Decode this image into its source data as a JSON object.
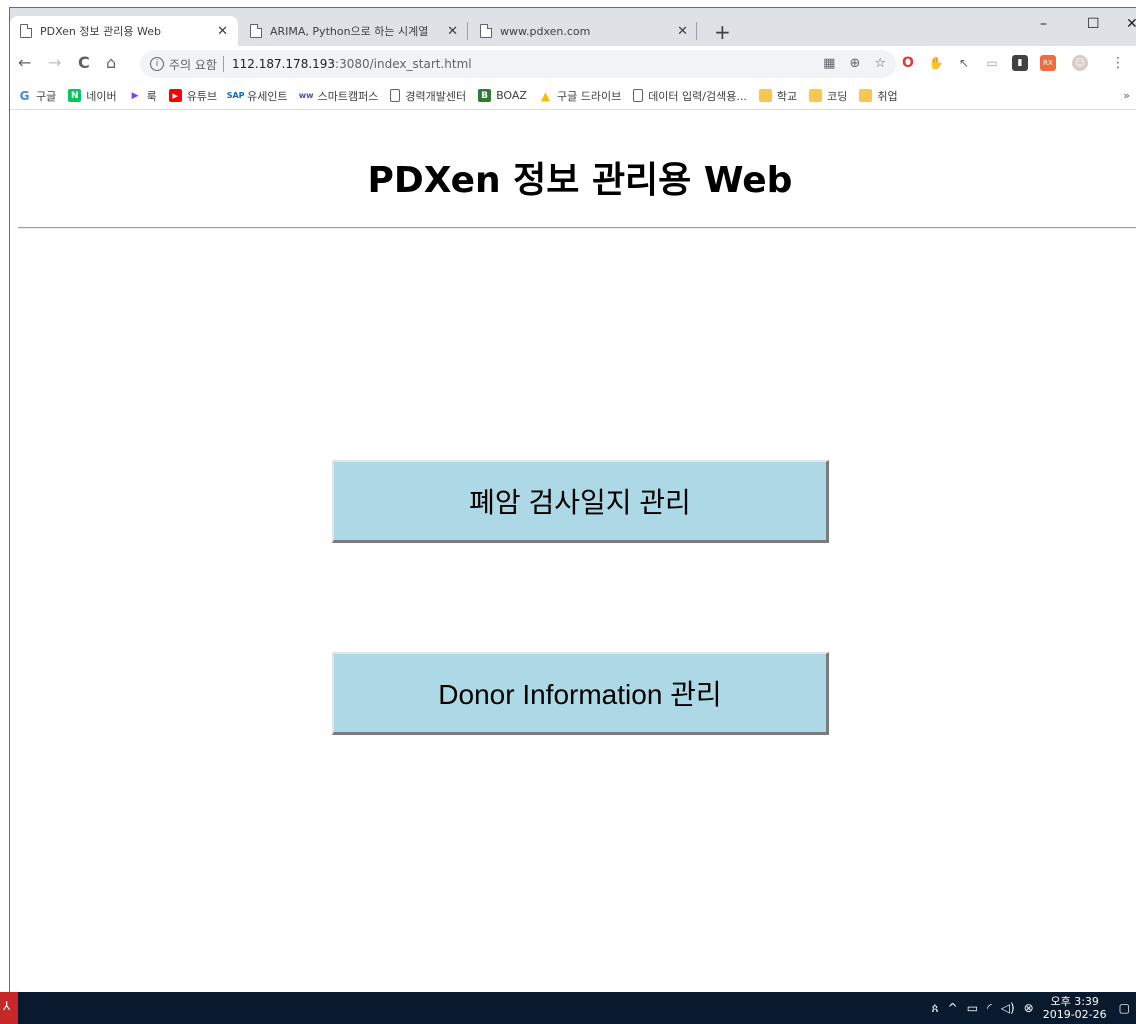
{
  "window": {
    "controls": {
      "minimize": "–",
      "maximize": "☐",
      "close": "✕"
    }
  },
  "tabs": [
    {
      "title": "PDXen 정보 관리용 Web",
      "active": true,
      "close": "✕"
    },
    {
      "title": "ARIMA, Python으로 하는 시계열",
      "active": false,
      "close": "✕"
    },
    {
      "title": "www.pdxen.com",
      "active": false,
      "close": "✕"
    }
  ],
  "new_tab": "+",
  "toolbar": {
    "back": "←",
    "forward": "→",
    "reload": "C",
    "home": "⌂",
    "security_icon": "i",
    "security_label": "주의 요함",
    "url_host": "112.187.178.193",
    "url_path": ":3080/index_start.html",
    "action_icons": [
      "translate-icon",
      "zoom-icon",
      "bookmark-star-icon"
    ]
  },
  "extensions": [
    {
      "name": "opera-icon",
      "color": "#e53935",
      "glyph": "O"
    },
    {
      "name": "hand-pointer-icon",
      "color": "#ffffff",
      "glyph": "✋"
    },
    {
      "name": "cursor-icon",
      "color": "#ffffff",
      "glyph": "↖"
    },
    {
      "name": "screen-icon",
      "color": "#ffffff",
      "glyph": "▭"
    },
    {
      "name": "dark-ext-icon",
      "color": "#424242",
      "glyph": "▮"
    },
    {
      "name": "rx-ext-icon",
      "color": "#ef6c3f",
      "glyph": "RX"
    }
  ],
  "bookmarks": [
    {
      "label": "구글",
      "icon": "google-icon",
      "color": "#4285f4",
      "glyph": "G"
    },
    {
      "label": "네이버",
      "icon": "naver-icon",
      "color": "#03c75a",
      "glyph": "N"
    },
    {
      "label": "룩",
      "icon": "play-icon",
      "color": "#7b3ff2",
      "glyph": "▶"
    },
    {
      "label": "유튜브",
      "icon": "youtube-icon",
      "color": "#ff0000",
      "glyph": "▶"
    },
    {
      "label": "유세인트",
      "icon": "sap-icon",
      "color": "#1565c0",
      "glyph": "S"
    },
    {
      "label": "스마트캠퍼스",
      "icon": "campus-icon",
      "color": "#3f51b5",
      "glyph": "~"
    },
    {
      "label": "경력개발센터",
      "icon": "page-icon",
      "color": "#ffffff",
      "glyph": ""
    },
    {
      "label": "BOAZ",
      "icon": "boaz-icon",
      "color": "#2e7d32",
      "glyph": "B"
    },
    {
      "label": "구글 드라이브",
      "icon": "drive-icon",
      "color": "#fbbc04",
      "glyph": "▲"
    },
    {
      "label": "데이터 입력/검색용...",
      "icon": "page-icon",
      "color": "#ffffff",
      "glyph": ""
    },
    {
      "label": "학교",
      "icon": "folder-icon",
      "color": "#f9c74f",
      "glyph": ""
    },
    {
      "label": "코딩",
      "icon": "folder-icon",
      "color": "#f9c74f",
      "glyph": ""
    },
    {
      "label": "취업",
      "icon": "folder-icon",
      "color": "#f9c74f",
      "glyph": ""
    }
  ],
  "bookmarks_more": "»",
  "page": {
    "title": "PDXen 정보 관리용 Web",
    "buttons": [
      {
        "label": "폐암 검사일지 관리"
      },
      {
        "label": "Donor Information 관리"
      }
    ]
  },
  "taskbar": {
    "tray_icons": [
      "people-icon",
      "chevron-up-icon",
      "battery-icon",
      "wifi-icon",
      "volume-icon",
      "network-error-icon"
    ],
    "clock_time": "오후 3:39",
    "clock_date": "2019-02-26",
    "notification_icon": "notification-icon"
  }
}
